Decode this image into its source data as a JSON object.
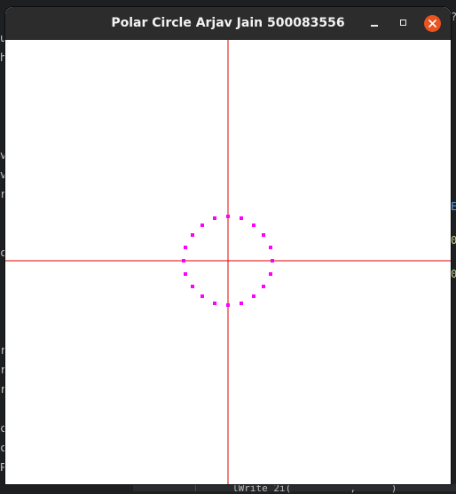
{
  "window": {
    "title": "Polar Circle Arjav Jain 500083556"
  },
  "window_controls": {
    "minimize": "minimize",
    "maximize": "maximize",
    "close": "close"
  },
  "colors": {
    "titlebar": "#2c2c2c",
    "close_button": "#e95420",
    "canvas_background": "#ffffff",
    "axis_line": "#e00000",
    "circle_points": "#ff00ff"
  },
  "background_fragments": {
    "left": [
      "u",
      "h",
      "v",
      "v",
      "r",
      "c",
      "r",
      "r",
      "r",
      "cl",
      "cl",
      "P"
    ],
    "right": [
      "?",
      "E",
      "0",
      "0"
    ],
    "bottom": "lWrite 2i(          ,      )"
  },
  "canvas": {
    "description_axes": "crosshair",
    "circle": {
      "type": "polar",
      "radius_units": 50,
      "point_count": 20
    }
  }
}
